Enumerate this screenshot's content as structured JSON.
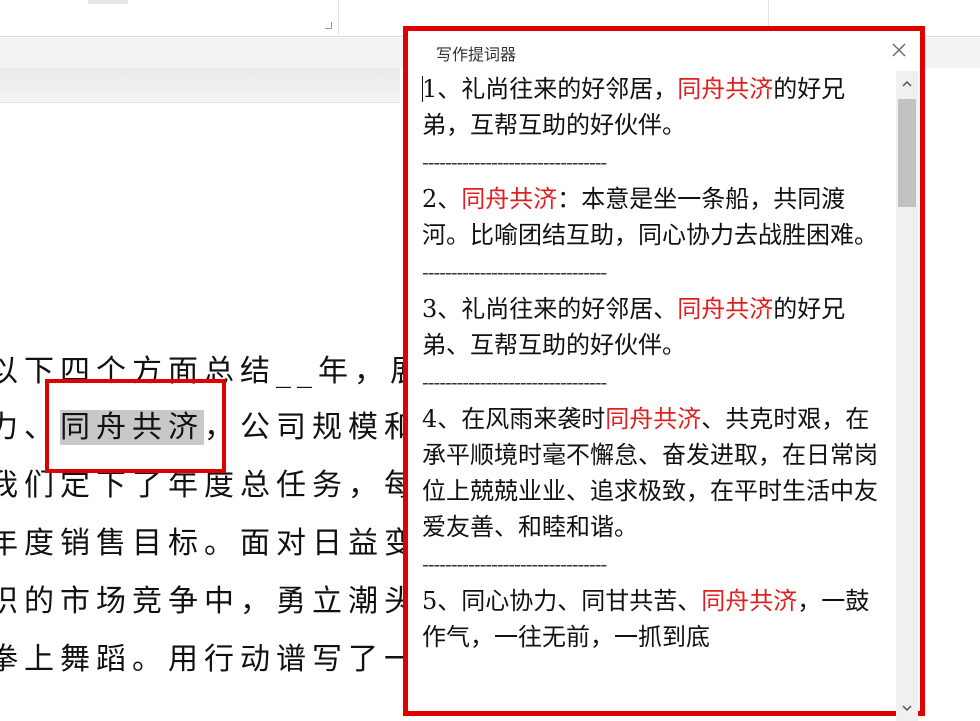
{
  "panel": {
    "title": "写作提词器",
    "separator": "--------------------------------",
    "entries": [
      {
        "pre": "1、礼尚往来的好邻居，",
        "hl": "同舟共济",
        "post": "的好兄弟，互帮互助的好伙伴。"
      },
      {
        "pre": "2、",
        "hl": "同舟共济",
        "post": "：本意是坐一条船，共同渡河。比喻团结互助，同心协力去战胜困难。"
      },
      {
        "pre": "3、礼尚往来的好邻居、",
        "hl": "同舟共济",
        "post": "的好兄弟、互帮互助的好伙伴。"
      },
      {
        "pre": "4、在风雨来袭时",
        "hl": "同舟共济",
        "post": "、共克时艰，在承平顺境时毫不懈怠、奋发进取，在日常岗位上兢兢业业、追求极致，在平时生活中友爱友善、和睦和谐。"
      },
      {
        "pre": "5、同心协力、同甘共苦、",
        "hl": "同舟共济",
        "post": "，一鼓作气，一往无前，一抓到底"
      }
    ]
  },
  "document": {
    "lines": [
      {
        "text": "以下四个方面总结__年，展望"
      },
      {
        "pre": "力、",
        "sel": "同舟共济",
        "post": "，公司规模和业"
      },
      {
        "text": "我们定下了年度总任务，每"
      },
      {
        "text": "年度销售目标。面对日益变化"
      },
      {
        "text": "织的市场竞争中，勇立潮头，"
      },
      {
        "text": "拳上舞蹈。用行动谱写了一"
      }
    ]
  },
  "colors": {
    "highlight_red": "#e00000",
    "keyword_red": "#e02020"
  },
  "icons": {
    "close": "close-icon",
    "scroll_up": "chevron-up-icon",
    "scroll_down": "chevron-down-icon"
  }
}
